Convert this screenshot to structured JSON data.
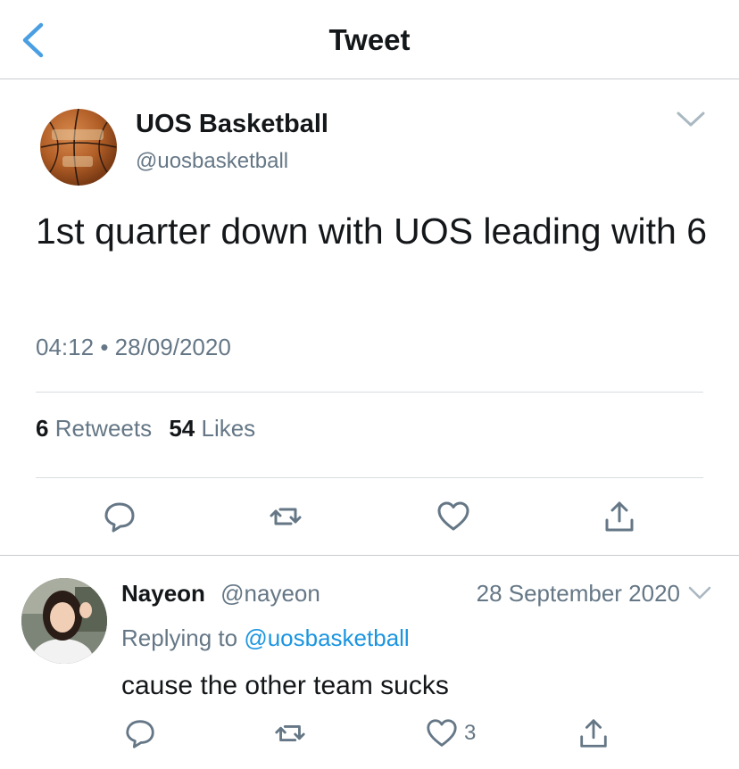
{
  "nav": {
    "title": "Tweet"
  },
  "tweet": {
    "author_name": "UOS Basketball",
    "author_handle": "@uosbasketball",
    "text": "1st quarter down with UOS leading with 6",
    "time": "04:12",
    "date_separator": "•",
    "date": "28/09/2020",
    "retweets_count": "6",
    "retweets_label": "Retweets",
    "likes_count": "54",
    "likes_label": "Likes"
  },
  "reply": {
    "author_name": "Nayeon",
    "author_handle": "@nayeon",
    "date": "28 September 2020",
    "replying_to_label": "Replying to",
    "replying_to_handle": "@uosbasketball",
    "text": "cause the other team sucks",
    "like_count": "3"
  },
  "icons": {
    "back": "chevron-left-icon",
    "more": "chevron-down-icon",
    "reply": "speech-bubble-icon",
    "retweet": "retweet-icon",
    "like": "heart-icon",
    "share": "share-icon"
  },
  "colors": {
    "accent": "#1b95e0",
    "back_arrow": "#4a9fe3",
    "text_primary": "#14171a",
    "text_secondary": "#657786",
    "icon_gray": "#657786",
    "divider": "#d8dde1"
  }
}
